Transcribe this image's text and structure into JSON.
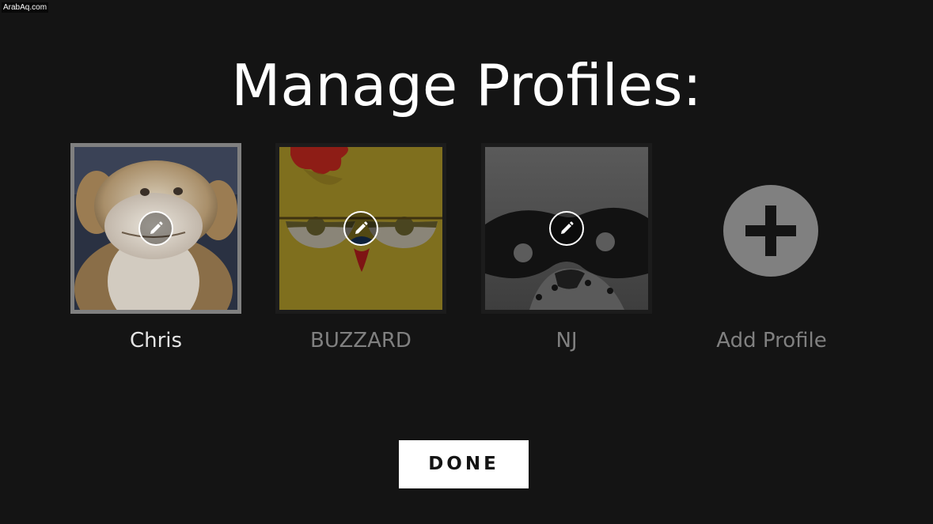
{
  "watermark": "ArabAq.com",
  "title": "Manage Profiles:",
  "profiles": [
    {
      "name": "Chris",
      "selected": true,
      "icon": "teddy-bear-avatar"
    },
    {
      "name": "BUZZARD",
      "selected": false,
      "icon": "chicken-avatar"
    },
    {
      "name": "NJ",
      "selected": false,
      "icon": "masked-dog-avatar"
    }
  ],
  "add_profile": {
    "label": "Add Profile",
    "icon": "plus-icon"
  },
  "done_label": "DONE",
  "colors": {
    "background": "#141414",
    "selected_border": "#808080",
    "active_name": "#e5e5e5",
    "inactive_name": "#808080",
    "button_bg": "#ffffff"
  }
}
